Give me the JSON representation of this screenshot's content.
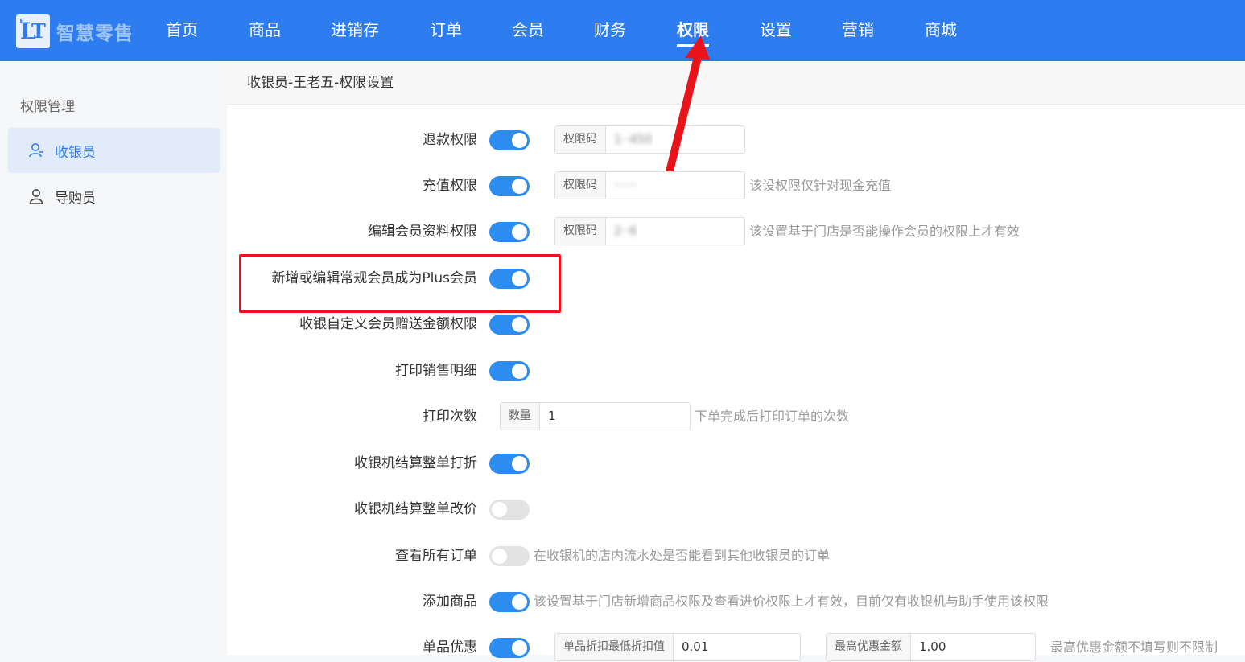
{
  "app": {
    "logo_text": "智慧零售"
  },
  "nav": {
    "items": [
      "首页",
      "商品",
      "进销存",
      "订单",
      "会员",
      "财务",
      "权限",
      "设置",
      "营销",
      "商城"
    ],
    "active": "权限"
  },
  "sidebar": {
    "title": "权限管理",
    "items": [
      {
        "label": "收银员",
        "icon": "user-icon",
        "active": true
      },
      {
        "label": "导购员",
        "icon": "user-icon",
        "active": false
      }
    ]
  },
  "main": {
    "header": "收银员-王老五-权限设置",
    "rows": [
      {
        "label": "退款权限",
        "enabled": true,
        "field_prefix": "权限码",
        "field_value": "1··450",
        "hint": ""
      },
      {
        "label": "充值权限",
        "enabled": true,
        "field_prefix": "权限码",
        "field_value": "······",
        "hint": "该设权限仅针对现金充值"
      },
      {
        "label": "编辑会员资料权限",
        "enabled": true,
        "field_prefix": "权限码",
        "field_value": "2··6",
        "hint": "该设置基于门店是否能操作会员的权限上才有效"
      },
      {
        "label": "新增或编辑常规会员成为Plus会员",
        "enabled": true
      },
      {
        "label": "收银自定义会员赠送金额权限",
        "enabled": true
      },
      {
        "label": "打印销售明细",
        "enabled": true
      },
      {
        "label": "打印次数",
        "field_prefix": "数量",
        "field_value": "1",
        "hint": "下单完成后打印订单的次数"
      },
      {
        "label": "收银机结算整单打折",
        "enabled": true
      },
      {
        "label": "收银机结算整单改价",
        "enabled": false
      },
      {
        "label": "查看所有订单",
        "enabled": false,
        "hint": "在收银机的店内流水处是否能看到其他收银员的订单"
      },
      {
        "label": "添加商品",
        "enabled": true,
        "hint": "该设置基于门店新增商品权限及查看进价权限上才有效，目前仅有收银机与助手使用该权限"
      },
      {
        "label": "单品优惠",
        "enabled": true,
        "field_prefix": "单品折扣最低折扣值",
        "field_value": "0.01",
        "field2_prefix": "最高优惠金额",
        "field2_value": "1.00",
        "hint": "最高优惠金额不填写则不限制"
      }
    ]
  },
  "colors": {
    "primary": "#2d7cf0",
    "switch_on": "#2d8cf0",
    "switch_off": "#e3e3e3",
    "annotation": "#e8141a"
  }
}
